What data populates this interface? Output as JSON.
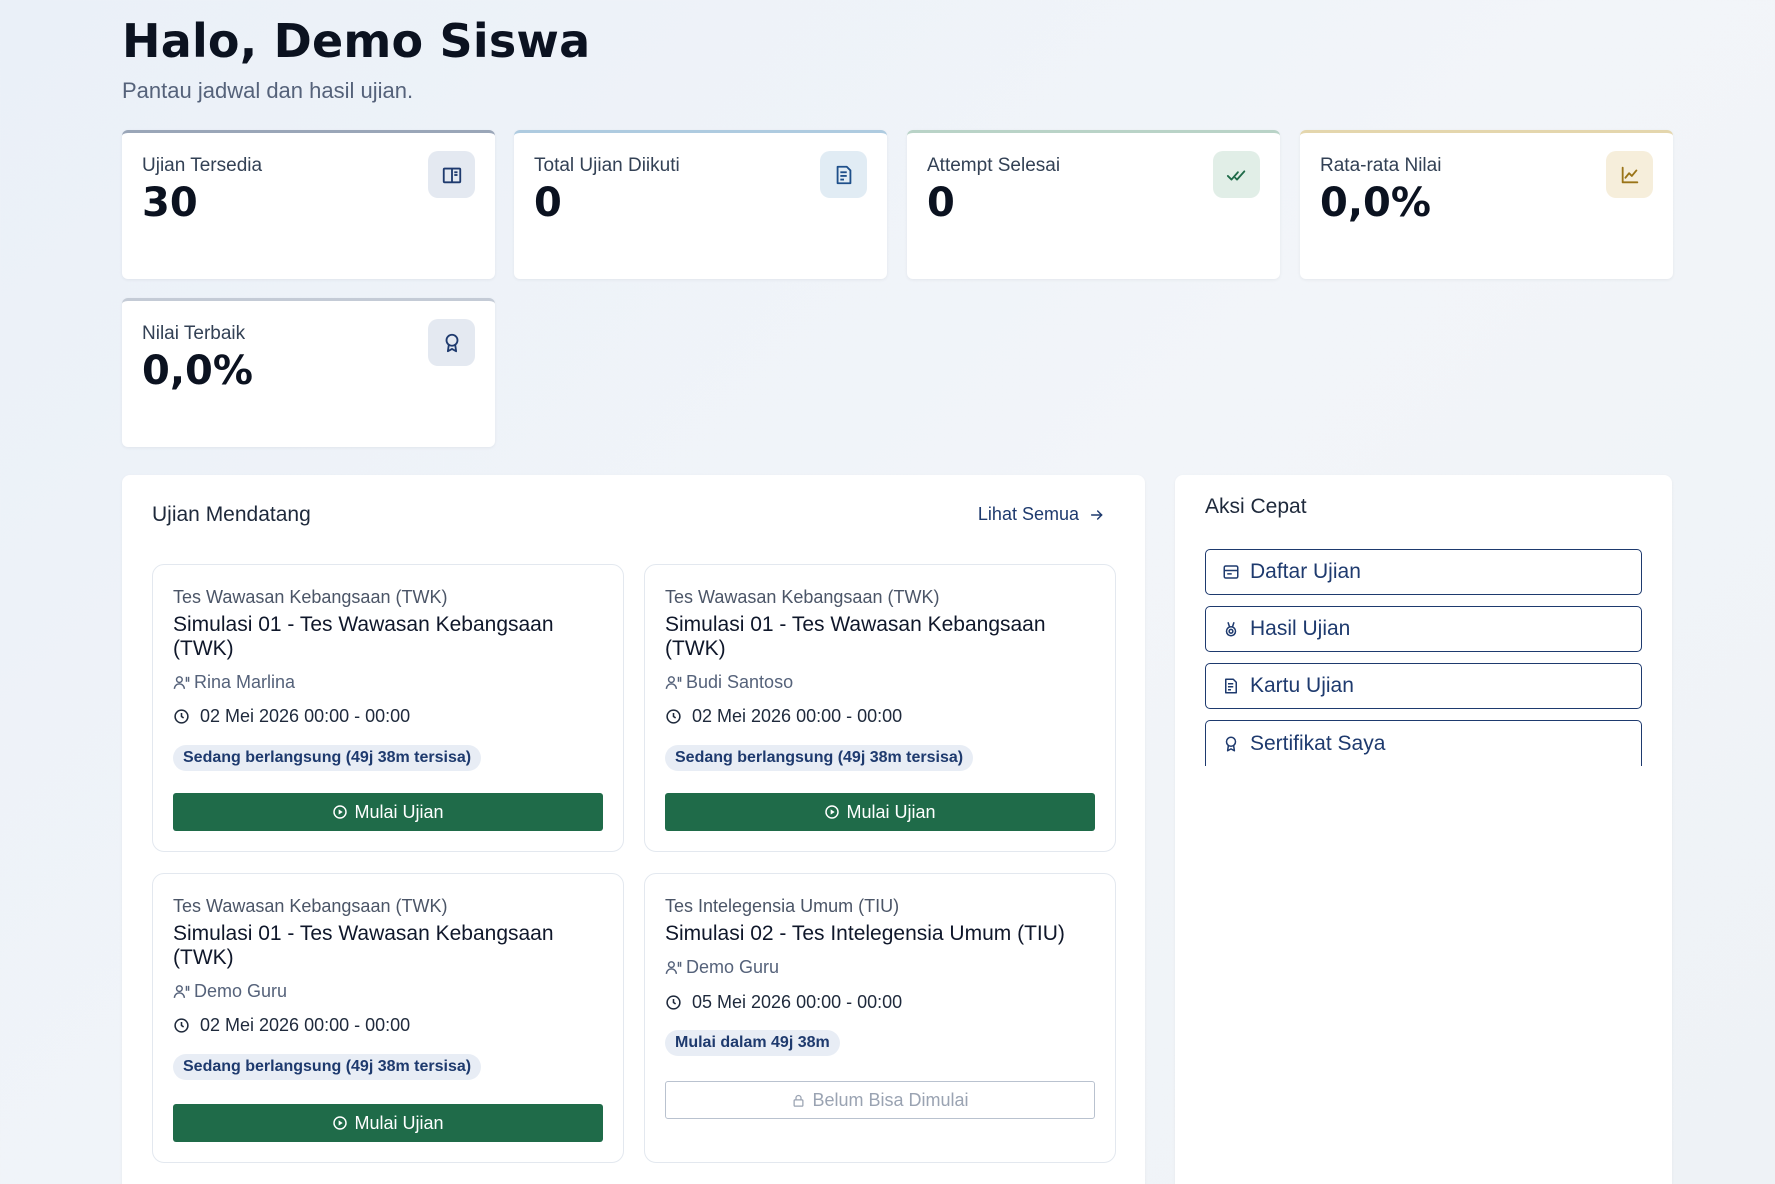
{
  "header": {
    "greeting": "Halo, Demo Siswa",
    "subtitle": "Pantau jadwal dan hasil ujian."
  },
  "stats": [
    {
      "label": "Ujian Tersedia",
      "value": "30",
      "icon": "book-open-icon",
      "accent": "#9aa6b8",
      "icon_bg": "#e4e9f1",
      "icon_color": "#1e3a6e"
    },
    {
      "label": "Total Ujian Diikuti",
      "value": "0",
      "icon": "document-list-icon",
      "accent": "#aecbe0",
      "icon_bg": "#e1ecf4",
      "icon_color": "#1e4f8a"
    },
    {
      "label": "Attempt Selesai",
      "value": "0",
      "icon": "double-check-icon",
      "accent": "#b9d3c7",
      "icon_bg": "#e1eee7",
      "icon_color": "#1f6b49"
    },
    {
      "label": "Rata-rata Nilai",
      "value": "0,0%",
      "icon": "line-chart-icon",
      "accent": "#e4d6ad",
      "icon_bg": "#f6eedb",
      "icon_color": "#9a7418"
    },
    {
      "label": "Nilai Terbaik",
      "value": "0,0%",
      "icon": "award-icon",
      "accent": "#c4cbd6",
      "icon_bg": "#e4e9f1",
      "icon_color": "#1e3a6e"
    }
  ],
  "upcoming": {
    "title": "Ujian Mendatang",
    "see_all": "Lihat Semua",
    "exams": [
      {
        "category": "Tes Wawasan Kebangsaan (TWK)",
        "title": "Simulasi 01 - Tes Wawasan Kebangsaan (TWK)",
        "teacher": "Rina Marlina",
        "date": "02 Mei 2026 00:00 - 00:00",
        "status": "Sedang berlangsung (49j 38m tersisa)",
        "action": "Mulai Ujian",
        "locked": false
      },
      {
        "category": "Tes Wawasan Kebangsaan (TWK)",
        "title": "Simulasi 01 - Tes Wawasan Kebangsaan (TWK)",
        "teacher": "Budi Santoso",
        "date": "02 Mei 2026 00:00 - 00:00",
        "status": "Sedang berlangsung (49j 38m tersisa)",
        "action": "Mulai Ujian",
        "locked": false
      },
      {
        "category": "Tes Wawasan Kebangsaan (TWK)",
        "title": "Simulasi 01 - Tes Wawasan Kebangsaan (TWK)",
        "teacher": "Demo Guru",
        "date": "02 Mei 2026 00:00 - 00:00",
        "status": "Sedang berlangsung (49j 38m tersisa)",
        "action": "Mulai Ujian",
        "locked": false
      },
      {
        "category": "Tes Intelegensia Umum (TIU)",
        "title": "Simulasi 02 - Tes Intelegensia Umum (TIU)",
        "teacher": "Demo Guru",
        "date": "05 Mei 2026 00:00 - 00:00",
        "status": "Mulai dalam 49j 38m",
        "action": "Belum Bisa Dimulai",
        "locked": true
      }
    ]
  },
  "quick_actions": {
    "title": "Aksi Cepat",
    "items": [
      {
        "label": "Daftar Ujian",
        "icon": "list-box-icon"
      },
      {
        "label": "Hasil Ujian",
        "icon": "medal-icon"
      },
      {
        "label": "Kartu Ujian",
        "icon": "document-list-icon"
      },
      {
        "label": "Sertifikat Saya",
        "icon": "award-icon"
      }
    ]
  },
  "colors": {
    "primary": "#1f6b49",
    "navy": "#1e3a6e"
  }
}
